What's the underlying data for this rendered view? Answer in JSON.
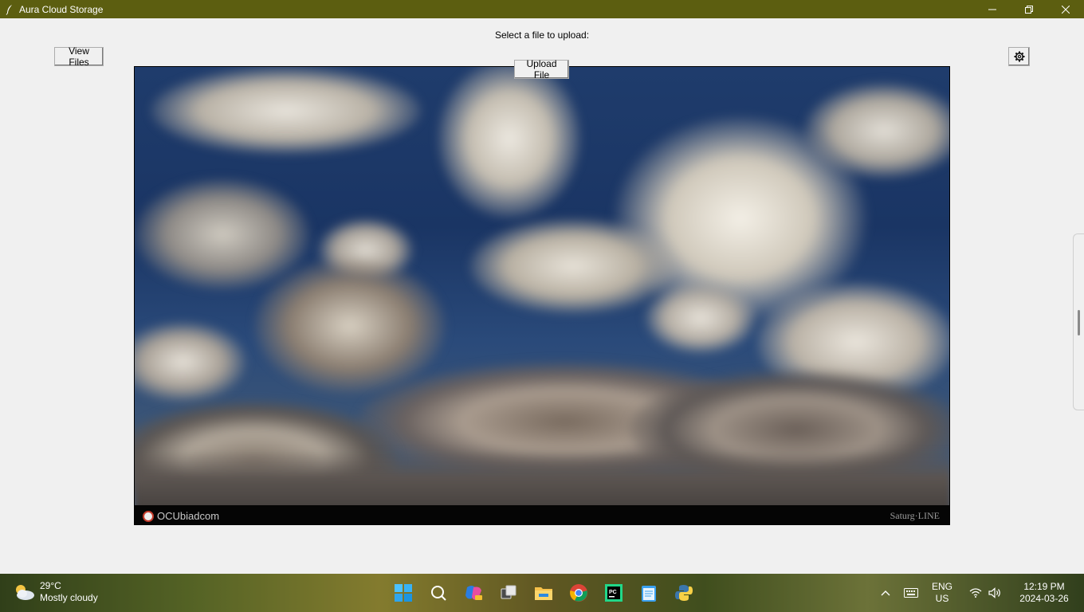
{
  "window": {
    "title": "Aura Cloud Storage",
    "controls": [
      "minimize",
      "restore",
      "close"
    ]
  },
  "main": {
    "prompt": "Select a file to upload:",
    "view_files_label": "View Files",
    "upload_file_label": "Upload File",
    "settings_icon": "gear-icon",
    "image": {
      "watermark_left": "OCUbiadcom",
      "watermark_right": "Saturg·LINE"
    }
  },
  "taskbar": {
    "weather": {
      "temperature": "29°C",
      "condition": "Mostly cloudy"
    },
    "apps": [
      "start-icon",
      "search-icon",
      "copilot-icon",
      "task-view-icon",
      "file-explorer-icon",
      "chrome-icon",
      "pycharm-icon",
      "notepad-icon",
      "python-icon"
    ],
    "tray": {
      "language_line1": "ENG",
      "language_line2": "US",
      "time": "12:19 PM",
      "date": "2024-03-26"
    }
  },
  "colors": {
    "titlebar": "#5c5e10",
    "client_bg": "#f0f0f0"
  }
}
